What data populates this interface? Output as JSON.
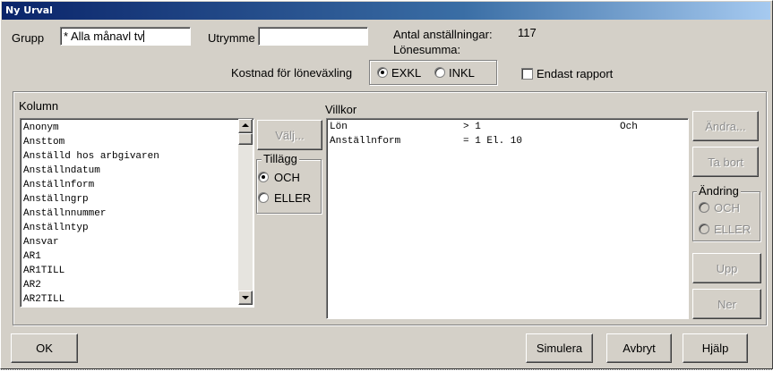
{
  "window": {
    "title": "Ny Urval"
  },
  "header": {
    "grupp_label": "Grupp",
    "grupp_value": "* Alla månavl tv",
    "utrymme_label": "Utrymme",
    "utrymme_value": "",
    "antal_label": "Antal anställningar:",
    "antal_value": "117",
    "lonesumma_label": "Lönesumma:",
    "kostnad_label": "Kostnad för löneväxling",
    "kostnad_options": [
      {
        "label": "EXKL",
        "checked": true
      },
      {
        "label": "INKL",
        "checked": false
      }
    ],
    "endast_rapport_label": "Endast rapport",
    "endast_rapport_checked": false
  },
  "kolumn": {
    "label": "Kolumn",
    "items": [
      "Anonym",
      "Ansttom",
      "Anställd hos arbgivaren",
      "Anställndatum",
      "Anställnform",
      "Anställngrp",
      "Anställnnummer",
      "Anställntyp",
      "Ansvar",
      "AR1",
      "AR1TILL",
      "AR2",
      "AR2TILL"
    ]
  },
  "middle": {
    "valj_label": "Välj...",
    "tillagg_label": "Tillägg",
    "tillagg_options": [
      {
        "label": "OCH",
        "checked": true
      },
      {
        "label": "ELLER",
        "checked": false
      }
    ]
  },
  "villkor": {
    "label": "Villkor",
    "rows": [
      {
        "field": "Lön",
        "condition": "> 1",
        "connector": "Och"
      },
      {
        "field": "Anställnform",
        "condition": "= 1 El. 10",
        "connector": ""
      }
    ]
  },
  "right_panel": {
    "andra_label": "Ändra...",
    "ta_bort_label": "Ta bort",
    "andring_label": "Ändring",
    "andring_options": [
      {
        "label": "OCH"
      },
      {
        "label": "ELLER"
      }
    ],
    "upp_label": "Upp",
    "ner_label": "Ner"
  },
  "footer": {
    "ok_label": "OK",
    "simulera_label": "Simulera",
    "avbryt_label": "Avbryt",
    "hjalp_label": "Hjälp"
  }
}
